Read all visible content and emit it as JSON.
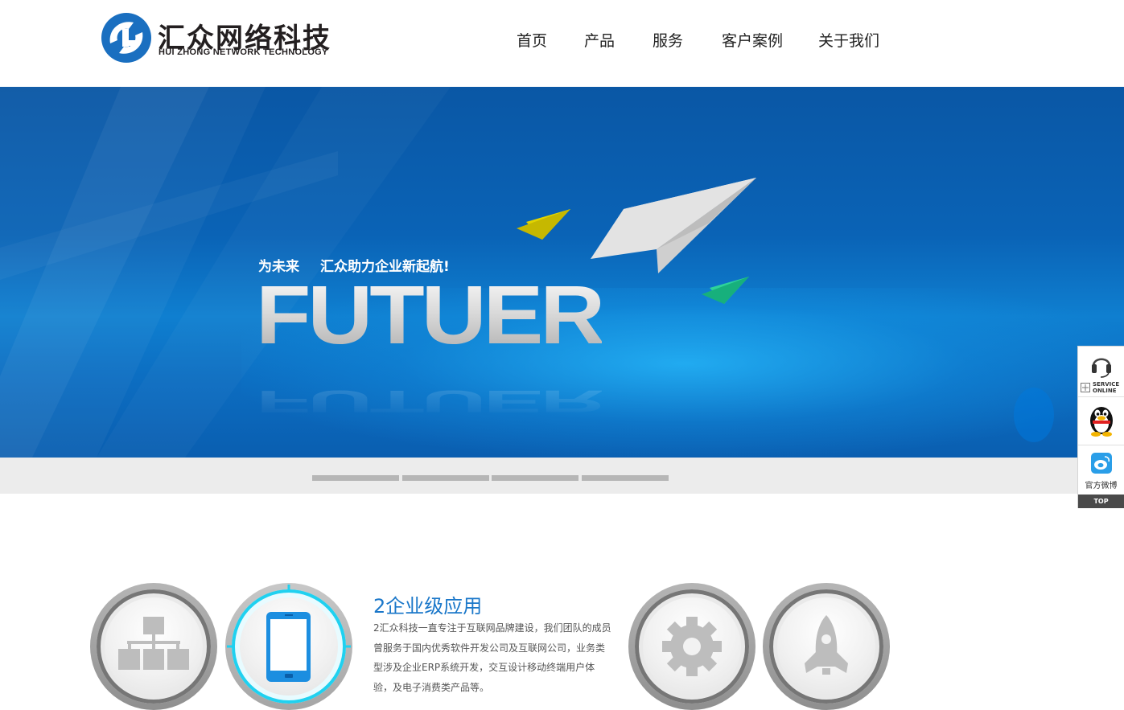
{
  "logo": {
    "name_cn": "汇众网络科技",
    "name_en": "HUI ZHONG NETWORK TECHNOLOGY"
  },
  "nav": {
    "items": [
      "首页",
      "产品",
      "服务",
      "客户案例",
      "关于我们"
    ]
  },
  "banner": {
    "tagline_a": "为未来",
    "tagline_b": "汇众助力企业新起航!",
    "word": "FUTUER"
  },
  "slider": {
    "dot_count": 4
  },
  "side_float": {
    "service_line1": "SERVICE",
    "service_line2": "ONLINE",
    "weibo_label": "官方微博",
    "top_label": "TOP"
  },
  "features": {
    "title": "2企业级应用",
    "description": "2汇众科技一直专注于互联网品牌建设，我们团队的成员曾服务于国内优秀软件开发公司及互联网公司，业务类型涉及企业ERP系统开发，交互设计移动终端用户体验，及电子消费类产品等。",
    "icons": [
      "sitemap-icon",
      "mobile-phone-icon",
      "gear-icon",
      "rocket-icon"
    ]
  },
  "colors": {
    "brand_blue": "#1a77c9",
    "banner_blue": "#0a63b6",
    "active_ring": "#1fd1f0"
  }
}
